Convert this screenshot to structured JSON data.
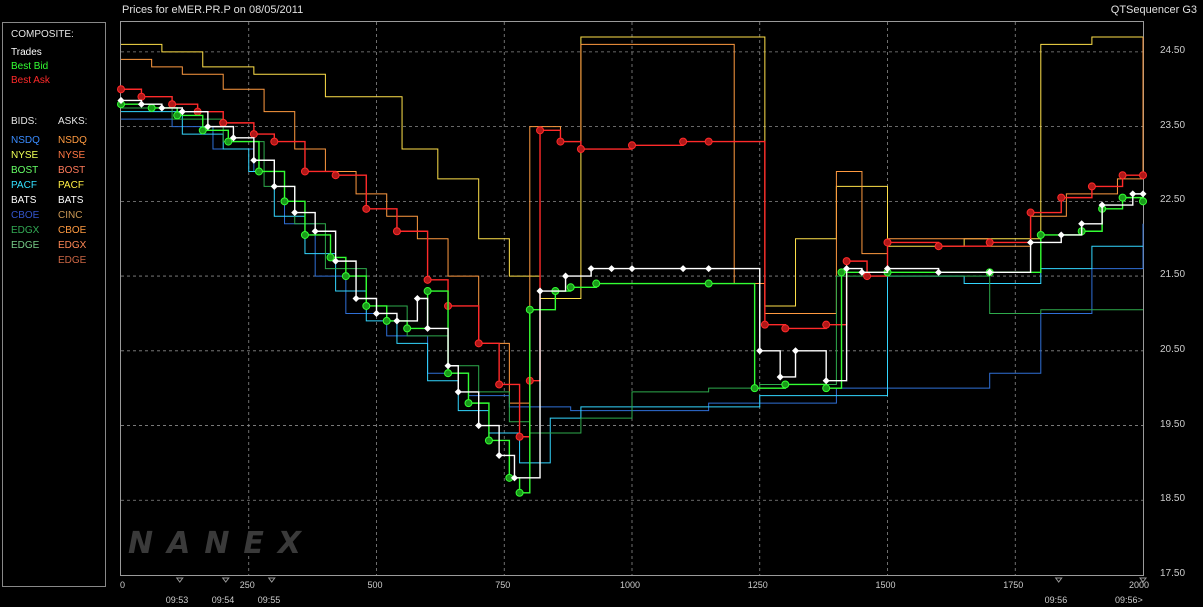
{
  "header": {
    "title_left": "Prices for  eMER.PR.P  on  08/05/2011",
    "title_right": "QTSequencer G3"
  },
  "legend": {
    "composite_label": "COMPOSITE:",
    "composite_items": [
      {
        "label": "Trades",
        "color": "#ffffff"
      },
      {
        "label": "Best Bid",
        "color": "#33ff33"
      },
      {
        "label": "Best Ask",
        "color": "#ff2a2a"
      }
    ],
    "bids_label": "BIDS:",
    "asks_label": "ASKS:",
    "bids": [
      {
        "label": "NSDQ",
        "color": "#3a8cff"
      },
      {
        "label": "NYSE",
        "color": "#eeff55"
      },
      {
        "label": "BOST",
        "color": "#66ff66"
      },
      {
        "label": "PACF",
        "color": "#33e0ff"
      },
      {
        "label": "BATS",
        "color": "#ffffff"
      },
      {
        "label": "CBOE",
        "color": "#3355cc"
      },
      {
        "label": "EDGX",
        "color": "#33aa55"
      },
      {
        "label": "EDGE",
        "color": "#77cc88"
      }
    ],
    "asks": [
      {
        "label": "NSDQ",
        "color": "#ff9a40"
      },
      {
        "label": "NYSE",
        "color": "#ff7744"
      },
      {
        "label": "BOST",
        "color": "#ff7a5a"
      },
      {
        "label": "PACF",
        "color": "#ffee44"
      },
      {
        "label": "BATS",
        "color": "#ffffff"
      },
      {
        "label": "CINC",
        "color": "#cc9955"
      },
      {
        "label": "CBOE",
        "color": "#ff9a40"
      },
      {
        "label": "EDGX",
        "color": "#ff8855"
      },
      {
        "label": "EDGE",
        "color": "#cc6644"
      }
    ]
  },
  "watermark": "NANEX",
  "chart_data": {
    "type": "line",
    "title": "Prices for  eMER.PR.P  on  08/05/2011",
    "xlim": [
      0,
      2000
    ],
    "ylim": [
      17.5,
      24.9
    ],
    "x_ticks": [
      "0",
      "250",
      "500",
      "750",
      "1000",
      "1250",
      "1500",
      "1750",
      "2000"
    ],
    "x_tick_values": [
      0,
      250,
      500,
      750,
      1000,
      1250,
      1500,
      1750,
      2000
    ],
    "y_ticks": [
      "24.50",
      "23.50",
      "22.50",
      "21.50",
      "20.50",
      "19.50",
      "18.50",
      "17.50"
    ],
    "y_tick_values": [
      24.5,
      23.5,
      22.5,
      21.5,
      20.5,
      19.5,
      18.5,
      17.5
    ],
    "time_labels": [
      {
        "label": "09:53",
        "x": 115
      },
      {
        "label": "09:54",
        "x": 205
      },
      {
        "label": "09:55",
        "x": 295
      },
      {
        "label": "09:56",
        "x": 1835
      },
      {
        "label": "09:56>",
        "x": 2000
      }
    ],
    "grid": true,
    "series": [
      {
        "name": "Trades",
        "color": "#ffffff",
        "points": [
          [
            0,
            23.85
          ],
          [
            40,
            23.8
          ],
          [
            80,
            23.75
          ],
          [
            120,
            23.7
          ],
          [
            170,
            23.5
          ],
          [
            220,
            23.35
          ],
          [
            260,
            23.05
          ],
          [
            300,
            22.7
          ],
          [
            340,
            22.35
          ],
          [
            380,
            22.1
          ],
          [
            420,
            21.7
          ],
          [
            460,
            21.2
          ],
          [
            500,
            21.0
          ],
          [
            540,
            20.9
          ],
          [
            580,
            21.2
          ],
          [
            600,
            20.8
          ],
          [
            640,
            20.3
          ],
          [
            660,
            19.95
          ],
          [
            700,
            19.5
          ],
          [
            740,
            19.1
          ],
          [
            770,
            18.8
          ],
          [
            820,
            21.3
          ],
          [
            870,
            21.5
          ],
          [
            920,
            21.6
          ],
          [
            960,
            21.6
          ],
          [
            1000,
            21.6
          ],
          [
            1100,
            21.6
          ],
          [
            1150,
            21.6
          ],
          [
            1250,
            20.5
          ],
          [
            1290,
            20.15
          ],
          [
            1320,
            20.5
          ],
          [
            1380,
            20.1
          ],
          [
            1420,
            21.6
          ],
          [
            1450,
            21.55
          ],
          [
            1500,
            21.6
          ],
          [
            1600,
            21.55
          ],
          [
            1700,
            21.55
          ],
          [
            1780,
            21.95
          ],
          [
            1840,
            22.05
          ],
          [
            1880,
            22.2
          ],
          [
            1920,
            22.45
          ],
          [
            1980,
            22.6
          ],
          [
            2000,
            22.6
          ]
        ]
      },
      {
        "name": "Best Bid",
        "color": "#33ff33",
        "points": [
          [
            0,
            23.8
          ],
          [
            60,
            23.75
          ],
          [
            110,
            23.65
          ],
          [
            160,
            23.45
          ],
          [
            210,
            23.3
          ],
          [
            270,
            22.9
          ],
          [
            320,
            22.5
          ],
          [
            360,
            22.05
          ],
          [
            410,
            21.75
          ],
          [
            440,
            21.5
          ],
          [
            480,
            21.1
          ],
          [
            520,
            20.9
          ],
          [
            560,
            20.8
          ],
          [
            600,
            21.3
          ],
          [
            640,
            20.2
          ],
          [
            680,
            19.8
          ],
          [
            720,
            19.3
          ],
          [
            760,
            18.8
          ],
          [
            780,
            18.6
          ],
          [
            800,
            21.05
          ],
          [
            850,
            21.3
          ],
          [
            880,
            21.35
          ],
          [
            930,
            21.4
          ],
          [
            1150,
            21.4
          ],
          [
            1240,
            20.0
          ],
          [
            1300,
            20.05
          ],
          [
            1380,
            20.0
          ],
          [
            1410,
            21.55
          ],
          [
            1500,
            21.55
          ],
          [
            1700,
            21.55
          ],
          [
            1800,
            22.05
          ],
          [
            1880,
            22.1
          ],
          [
            1920,
            22.4
          ],
          [
            1960,
            22.55
          ],
          [
            2000,
            22.5
          ]
        ]
      },
      {
        "name": "Best Ask",
        "color": "#ff2a2a",
        "points": [
          [
            0,
            24.0
          ],
          [
            40,
            23.9
          ],
          [
            100,
            23.8
          ],
          [
            150,
            23.7
          ],
          [
            200,
            23.55
          ],
          [
            260,
            23.4
          ],
          [
            300,
            23.3
          ],
          [
            360,
            22.9
          ],
          [
            420,
            22.85
          ],
          [
            480,
            22.4
          ],
          [
            540,
            22.1
          ],
          [
            600,
            21.45
          ],
          [
            640,
            21.1
          ],
          [
            700,
            20.6
          ],
          [
            740,
            20.05
          ],
          [
            780,
            19.35
          ],
          [
            800,
            20.1
          ],
          [
            820,
            23.45
          ],
          [
            860,
            23.3
          ],
          [
            900,
            23.2
          ],
          [
            1000,
            23.25
          ],
          [
            1100,
            23.3
          ],
          [
            1150,
            23.3
          ],
          [
            1260,
            20.85
          ],
          [
            1300,
            20.8
          ],
          [
            1380,
            20.85
          ],
          [
            1420,
            21.7
          ],
          [
            1460,
            21.5
          ],
          [
            1500,
            21.95
          ],
          [
            1600,
            21.9
          ],
          [
            1700,
            21.95
          ],
          [
            1780,
            22.35
          ],
          [
            1840,
            22.55
          ],
          [
            1900,
            22.7
          ],
          [
            1960,
            22.85
          ],
          [
            2000,
            22.85
          ]
        ]
      },
      {
        "name": "NSDQ",
        "color": "#ff9a40",
        "points": [
          [
            0,
            24.4
          ],
          [
            60,
            24.3
          ],
          [
            120,
            24.2
          ],
          [
            200,
            24.0
          ],
          [
            280,
            23.7
          ],
          [
            340,
            23.2
          ],
          [
            400,
            22.9
          ],
          [
            460,
            22.6
          ],
          [
            520,
            22.3
          ],
          [
            580,
            22.0
          ],
          [
            640,
            21.5
          ],
          [
            700,
            20.6
          ],
          [
            760,
            19.8
          ],
          [
            800,
            23.5
          ],
          [
            860,
            23.3
          ],
          [
            900,
            24.6
          ],
          [
            1000,
            24.6
          ],
          [
            1150,
            24.6
          ],
          [
            1200,
            21.4
          ],
          [
            1260,
            21.0
          ],
          [
            1300,
            21.0
          ],
          [
            1400,
            22.9
          ],
          [
            1450,
            21.8
          ],
          [
            1500,
            22.0
          ],
          [
            1700,
            21.9
          ],
          [
            1780,
            22.3
          ],
          [
            1850,
            22.6
          ],
          [
            1950,
            22.8
          ],
          [
            2000,
            24.7
          ]
        ]
      },
      {
        "name": "NYSE",
        "color": "#ffe14a",
        "points": [
          [
            0,
            24.6
          ],
          [
            80,
            24.5
          ],
          [
            160,
            24.3
          ],
          [
            260,
            24.2
          ],
          [
            400,
            23.9
          ],
          [
            550,
            23.2
          ],
          [
            620,
            22.8
          ],
          [
            700,
            22.0
          ],
          [
            760,
            21.5
          ],
          [
            820,
            21.2
          ],
          [
            900,
            24.7
          ],
          [
            1100,
            24.7
          ],
          [
            1240,
            24.7
          ],
          [
            1260,
            21.1
          ],
          [
            1320,
            22.0
          ],
          [
            1400,
            22.7
          ],
          [
            1500,
            21.9
          ],
          [
            1650,
            22.0
          ],
          [
            1800,
            24.6
          ],
          [
            1900,
            24.7
          ],
          [
            2000,
            24.7
          ]
        ]
      },
      {
        "name": "CBOE",
        "color": "#2f6fd6",
        "points": [
          [
            0,
            23.6
          ],
          [
            100,
            23.5
          ],
          [
            180,
            23.2
          ],
          [
            260,
            22.9
          ],
          [
            320,
            22.2
          ],
          [
            380,
            21.5
          ],
          [
            440,
            21.0
          ],
          [
            520,
            20.7
          ],
          [
            600,
            20.2
          ],
          [
            680,
            19.9
          ],
          [
            760,
            19.75
          ],
          [
            880,
            19.7
          ],
          [
            1000,
            19.7
          ],
          [
            1150,
            19.8
          ],
          [
            1250,
            19.8
          ],
          [
            1400,
            20.0
          ],
          [
            1560,
            20.0
          ],
          [
            1700,
            20.2
          ],
          [
            1800,
            21.0
          ],
          [
            1900,
            21.6
          ],
          [
            2000,
            22.2
          ]
        ]
      },
      {
        "name": "PACF",
        "color": "#33d6ff",
        "points": [
          [
            0,
            23.7
          ],
          [
            120,
            23.4
          ],
          [
            200,
            23.2
          ],
          [
            250,
            22.9
          ],
          [
            300,
            22.3
          ],
          [
            360,
            21.8
          ],
          [
            420,
            21.3
          ],
          [
            480,
            20.9
          ],
          [
            540,
            20.6
          ],
          [
            600,
            20.1
          ],
          [
            660,
            19.7
          ],
          [
            720,
            19.4
          ],
          [
            780,
            19.0
          ],
          [
            840,
            19.6
          ],
          [
            900,
            19.75
          ],
          [
            1000,
            19.75
          ],
          [
            1150,
            19.75
          ],
          [
            1250,
            19.9
          ],
          [
            1350,
            19.9
          ],
          [
            1500,
            21.5
          ],
          [
            1650,
            21.4
          ],
          [
            1800,
            21.6
          ],
          [
            1900,
            21.9
          ],
          [
            2000,
            21.9
          ]
        ]
      },
      {
        "name": "EDGX",
        "color": "#2eaa4c",
        "points": [
          [
            0,
            23.75
          ],
          [
            100,
            23.6
          ],
          [
            200,
            23.3
          ],
          [
            280,
            22.7
          ],
          [
            340,
            22.2
          ],
          [
            400,
            21.6
          ],
          [
            480,
            21.1
          ],
          [
            560,
            20.7
          ],
          [
            640,
            20.3
          ],
          [
            700,
            19.95
          ],
          [
            760,
            19.55
          ],
          [
            800,
            19.4
          ],
          [
            900,
            19.6
          ],
          [
            1000,
            19.95
          ],
          [
            1150,
            20.0
          ],
          [
            1250,
            20.05
          ],
          [
            1400,
            21.5
          ],
          [
            1550,
            21.5
          ],
          [
            1700,
            21.0
          ],
          [
            1800,
            21.05
          ],
          [
            2000,
            21.05
          ]
        ]
      }
    ]
  }
}
